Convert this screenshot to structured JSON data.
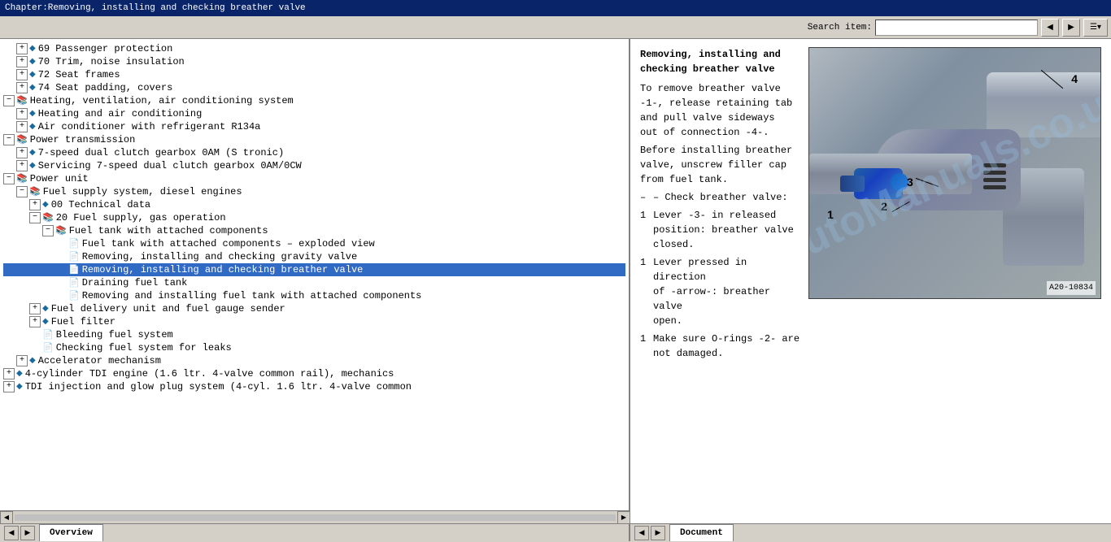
{
  "titlebar": {
    "text": "Chapter:Removing, installing and checking breather valve"
  },
  "toolbar": {
    "search_label": "Search item:",
    "search_placeholder": ""
  },
  "tree": {
    "items": [
      {
        "id": 1,
        "level": 2,
        "type": "expandable",
        "icon": "diamond",
        "label": "69  Passenger protection",
        "expanded": false
      },
      {
        "id": 2,
        "level": 2,
        "type": "expandable",
        "icon": "diamond",
        "label": "70  Trim, noise insulation",
        "expanded": false
      },
      {
        "id": 3,
        "level": 2,
        "type": "expandable",
        "icon": "diamond",
        "label": "72  Seat frames",
        "expanded": false
      },
      {
        "id": 4,
        "level": 2,
        "type": "expandable",
        "icon": "diamond",
        "label": "74  Seat padding, covers",
        "expanded": false
      },
      {
        "id": 5,
        "level": 1,
        "type": "folder",
        "icon": "book",
        "label": "Heating, ventilation, air conditioning system",
        "expanded": false
      },
      {
        "id": 6,
        "level": 2,
        "type": "expandable",
        "icon": "diamond",
        "label": "Heating and air conditioning",
        "expanded": false
      },
      {
        "id": 7,
        "level": 2,
        "type": "expandable",
        "icon": "diamond",
        "label": "Air conditioner with refrigerant R134a",
        "expanded": false
      },
      {
        "id": 8,
        "level": 1,
        "type": "folder",
        "icon": "book",
        "label": "Power transmission",
        "expanded": false
      },
      {
        "id": 9,
        "level": 2,
        "type": "expandable",
        "icon": "diamond",
        "label": "7-speed dual clutch gearbox 0AM (S tronic)",
        "expanded": false
      },
      {
        "id": 10,
        "level": 2,
        "type": "expandable",
        "icon": "diamond",
        "label": "Servicing 7-speed dual clutch gearbox 0AM/0CW",
        "expanded": false
      },
      {
        "id": 11,
        "level": 1,
        "type": "folder",
        "icon": "book",
        "label": "Power unit",
        "expanded": true
      },
      {
        "id": 12,
        "level": 2,
        "type": "folder",
        "icon": "book",
        "label": "Fuel supply system, diesel engines",
        "expanded": true
      },
      {
        "id": 13,
        "level": 3,
        "type": "expandable",
        "icon": "diamond",
        "label": "00  Technical data",
        "expanded": false
      },
      {
        "id": 14,
        "level": 3,
        "type": "folder",
        "icon": "book",
        "label": "20  Fuel supply, gas operation",
        "expanded": true
      },
      {
        "id": 15,
        "level": 4,
        "type": "folder",
        "icon": "book",
        "label": "Fuel tank with attached components",
        "expanded": true
      },
      {
        "id": 16,
        "level": 5,
        "type": "doc",
        "icon": "doc",
        "label": "Fuel tank with attached components – exploded view",
        "selected": false
      },
      {
        "id": 17,
        "level": 5,
        "type": "doc",
        "icon": "doc",
        "label": "Removing, installing and checking gravity valve",
        "selected": false
      },
      {
        "id": 18,
        "level": 5,
        "type": "doc",
        "icon": "doc",
        "label": "Removing, installing and checking breather valve",
        "selected": true
      },
      {
        "id": 19,
        "level": 5,
        "type": "doc",
        "icon": "doc",
        "label": "Draining fuel tank",
        "selected": false
      },
      {
        "id": 20,
        "level": 5,
        "type": "doc",
        "icon": "doc",
        "label": "Removing and installing fuel tank with attached components",
        "selected": false
      },
      {
        "id": 21,
        "level": 3,
        "type": "expandable",
        "icon": "diamond",
        "label": "Fuel delivery unit and fuel gauge sender",
        "expanded": false
      },
      {
        "id": 22,
        "level": 3,
        "type": "expandable",
        "icon": "diamond",
        "label": "Fuel filter",
        "expanded": false
      },
      {
        "id": 23,
        "level": 3,
        "type": "doc",
        "icon": "doc",
        "label": "Bleeding fuel system",
        "selected": false
      },
      {
        "id": 24,
        "level": 3,
        "type": "doc",
        "icon": "doc",
        "label": "Checking fuel system for leaks",
        "selected": false
      },
      {
        "id": 25,
        "level": 2,
        "type": "expandable",
        "icon": "diamond",
        "label": "Accelerator mechanism",
        "expanded": false
      },
      {
        "id": 26,
        "level": 1,
        "type": "expandable",
        "icon": "diamond",
        "label": "4-cylinder TDI engine (1.6 ltr. 4-valve common rail), mechanics",
        "expanded": false
      },
      {
        "id": 27,
        "level": 1,
        "type": "expandable",
        "icon": "diamond",
        "label": "TDI injection and glow plug system (4-cyl. 1.6 ltr. 4-valve common",
        "expanded": false
      }
    ]
  },
  "content": {
    "title": "Removing, installing and\nchecking breather valve",
    "paragraphs": [
      "To remove breather valve\n-1-, release retaining tab\nand pull valve sideways\nout of connection -4-.",
      "Before installing breather\nvalve, unscrew filler cap\nfrom fuel tank.",
      "– Check breather valve:",
      "Lever -3- in released\nposition: breather valve\nclosed.",
      "Lever pressed in direction\nof -arrow-: breather valve\nopen.",
      "Make sure O-rings -2- are\nnot damaged."
    ],
    "list_markers": [
      "",
      "",
      "–",
      "1",
      "1",
      "1"
    ],
    "image_ref": "A20-10834",
    "callouts": [
      "1",
      "2",
      "3",
      "4"
    ],
    "watermark": "autoManuals.co.uk"
  },
  "statusbar": {
    "overview_tab": "Overview",
    "document_tab": "Document"
  }
}
